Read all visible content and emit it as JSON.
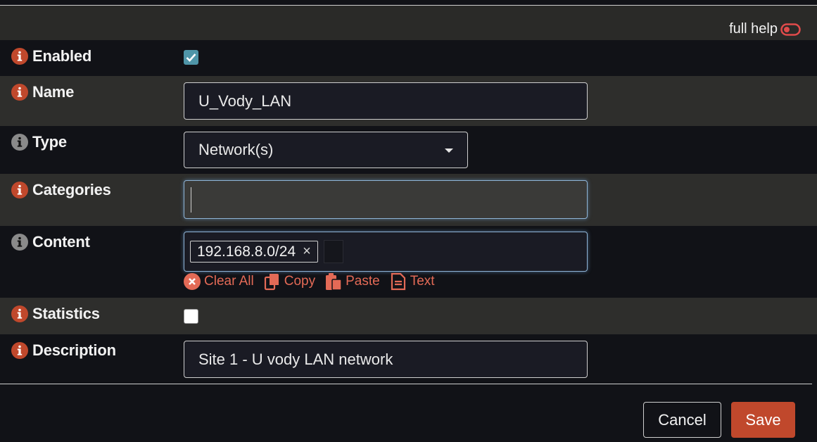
{
  "help": {
    "label": "full help",
    "toggle_icon": "toggle-off-icon"
  },
  "fields": {
    "enabled": {
      "label": "Enabled",
      "checked": true
    },
    "name": {
      "label": "Name",
      "value": "U_Vody_LAN"
    },
    "type": {
      "label": "Type",
      "value": "Network(s)"
    },
    "categories": {
      "label": "Categories",
      "value": ""
    },
    "content": {
      "label": "Content",
      "tags": [
        "192.168.8.0/24"
      ],
      "tag_remove": "×",
      "actions": {
        "clear_all": "Clear All",
        "copy": "Copy",
        "paste": "Paste",
        "text": "Text"
      }
    },
    "statistics": {
      "label": "Statistics",
      "checked": false
    },
    "description": {
      "label": "Description",
      "value": "Site 1 - U vody LAN network"
    }
  },
  "buttons": {
    "cancel": "Cancel",
    "save": "Save"
  },
  "colors": {
    "info_orange": "#c0482c",
    "info_grey": "#8a8a8a",
    "accent": "#c0482c",
    "link": "#e36a56",
    "checkbox": "#4f95a8"
  }
}
